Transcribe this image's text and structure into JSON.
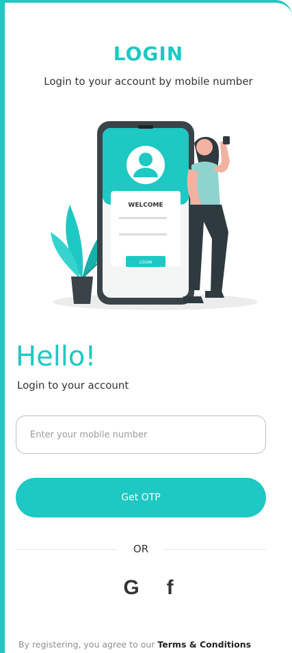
{
  "header": {
    "title": "LOGIN",
    "subtitle": "Login to your account by mobile number"
  },
  "illustration": {
    "phone_text": "WELCOME",
    "phone_button": "LOGIN",
    "colors": {
      "accent": "#1ec8c3",
      "dark": "#2f3a3f"
    }
  },
  "form": {
    "greeting": "Hello!",
    "greeting_sub": "Login to your account",
    "mobile_placeholder": "Enter your mobile number",
    "mobile_value": "",
    "submit_label": "Get OTP",
    "divider_label": "OR"
  },
  "social": [
    {
      "icon": "google-icon",
      "glyph": "G"
    },
    {
      "icon": "facebook-icon",
      "glyph": "f"
    }
  ],
  "footer": {
    "text": "By registering, you agree to our",
    "link": "Terms & Conditions"
  },
  "theme": {
    "accent": "#1ec8c3",
    "text": "#333333"
  }
}
